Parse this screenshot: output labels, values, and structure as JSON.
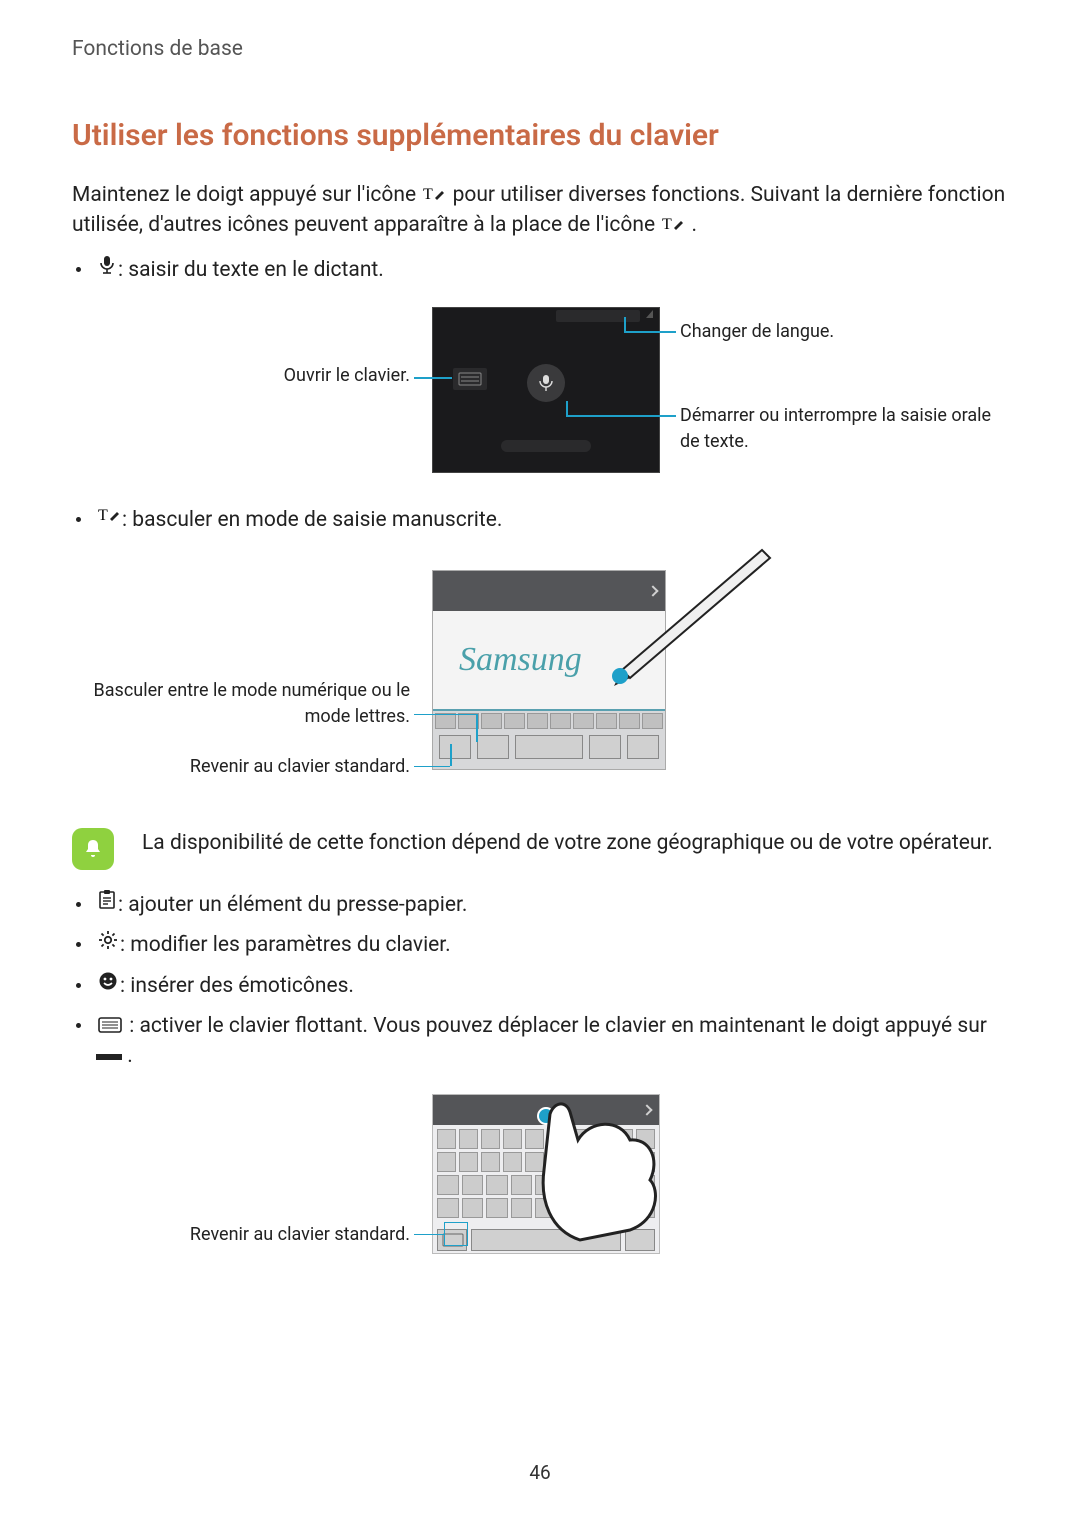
{
  "header": {
    "breadcrumb": "Fonctions de base"
  },
  "section": {
    "title": "Utiliser les fonctions supplémentaires du clavier",
    "intro_before": "Maintenez le doigt appuyé sur l'icône ",
    "intro_mid": " pour utiliser diverses fonctions. Suivant la dernière fonction utilisée, d'autres icônes peuvent apparaître à la place de l'icône ",
    "intro_after": "."
  },
  "bullets": {
    "mic": " : saisir du texte en le dictant.",
    "handwriting": " : basculer en mode de saisie manuscrite.",
    "clipboard": " : ajouter un élément du presse-papier.",
    "settings": " : modifier les paramètres du clavier.",
    "emoji": " : insérer des émoticônes.",
    "floating_before": " : activer le clavier flottant. Vous pouvez déplacer le clavier en maintenant le doigt appuyé sur ",
    "floating_after": "."
  },
  "figure1": {
    "left_label": "Ouvrir le clavier.",
    "right_top": "Changer de langue.",
    "right_bottom": "Démarrer ou interrompre la saisie orale de texte."
  },
  "figure2": {
    "handwriting_text": "Samsung",
    "left_top": "Basculer entre le mode numérique ou le mode lettres.",
    "left_bottom": "Revenir au clavier standard."
  },
  "note": {
    "text": "La disponibilité de cette fonction dépend de votre zone géographique ou de votre opérateur."
  },
  "figure3": {
    "left_label": "Revenir au clavier standard."
  },
  "page_number": "46"
}
